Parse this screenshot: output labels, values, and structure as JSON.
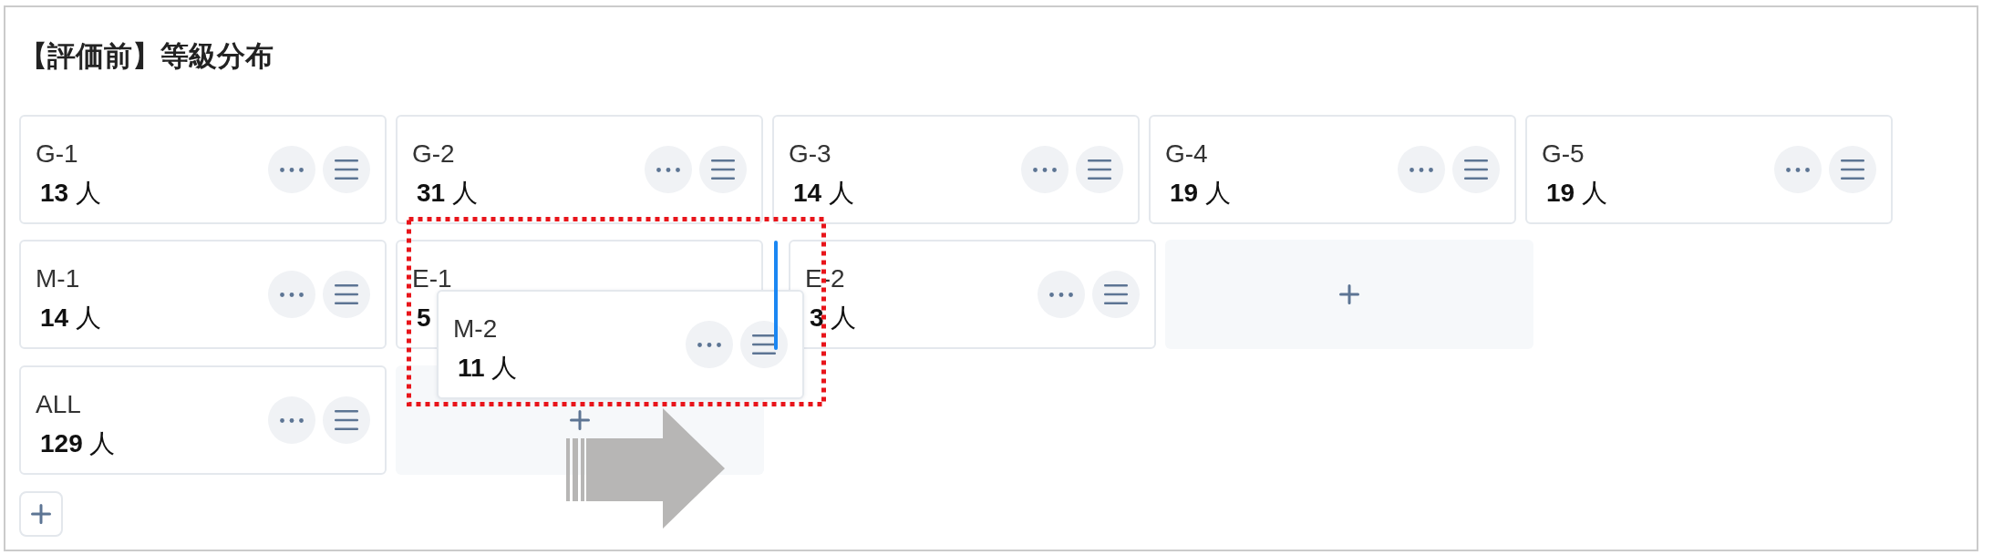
{
  "panel": {
    "title": "【評価前】等級分布",
    "rows": [
      {
        "items": [
          {
            "kind": "card",
            "label": "G-1",
            "count": "**13** 人",
            "covered": false
          },
          {
            "kind": "card",
            "label": "G-2",
            "count": "**31** 人",
            "covered": false
          },
          {
            "kind": "card",
            "label": "G-3",
            "count": "**14** 人",
            "covered": false
          },
          {
            "kind": "card",
            "label": "G-4",
            "count": "**19** 人",
            "covered": false
          },
          {
            "kind": "card",
            "label": "G-5",
            "count": "**19** 人",
            "covered": false
          }
        ]
      },
      {
        "items": [
          {
            "kind": "card",
            "label": "M-1",
            "count": "**14** 人",
            "covered": false
          },
          {
            "kind": "card",
            "label": "E-1",
            "count": "**5**",
            "covered": true
          },
          {
            "kind": "drop_marker"
          },
          {
            "kind": "card",
            "label": "E-2",
            "count": "**3** 人",
            "covered": false
          },
          {
            "kind": "add_slot"
          }
        ]
      },
      {
        "items": [
          {
            "kind": "card",
            "label": "ALL",
            "count": "**129** 人",
            "covered": false
          },
          {
            "kind": "add_slot"
          }
        ]
      }
    ],
    "dragged_card": {
      "label": "M-2",
      "count": "**11** 人"
    }
  }
}
